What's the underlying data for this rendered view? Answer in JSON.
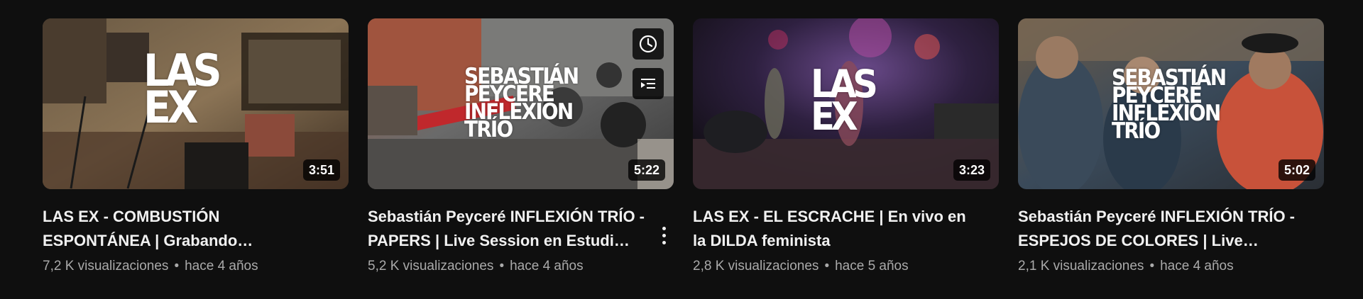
{
  "videos": [
    {
      "thumb_text": "LAS\nEX",
      "duration": "3:51",
      "title": "LAS EX - COMBUSTIÓN ESPONTÁNEA | Grabando…",
      "views": "7,2 K visualizaciones",
      "separator": "•",
      "age": "hace 4 años"
    },
    {
      "thumb_text": "SEBASTIÁN\nPEYCERÉ\nINFLEXION\nTRÍO",
      "duration": "5:22",
      "title": "Sebastián Peyceré INFLEXIÓN TRÍO - PAPERS | Live Session en Estudi…",
      "views": "5,2 K visualizaciones",
      "separator": "•",
      "age": "hace 4 años",
      "hover_actions": [
        "watch-later-icon",
        "add-to-queue-icon"
      ],
      "has_menu": true
    },
    {
      "thumb_text": "LAS\nEX",
      "duration": "3:23",
      "title": "LAS EX - EL ESCRACHE | En vivo en la DILDA feminista",
      "views": "2,8 K visualizaciones",
      "separator": "•",
      "age": "hace 5 años"
    },
    {
      "thumb_text": "SEBASTIÁN\nPEYCERÉ\nINFLEXION\nTRÍO",
      "duration": "5:02",
      "title": "Sebastián Peyceré INFLEXIÓN TRÍO - ESPEJOS DE COLORES | Live…",
      "views": "2,1 K visualizaciones",
      "separator": "•",
      "age": "hace 4 años"
    }
  ],
  "colors": {
    "background": "#0f0f0f",
    "title": "#f1f1f1",
    "meta": "#aaaaaa"
  }
}
